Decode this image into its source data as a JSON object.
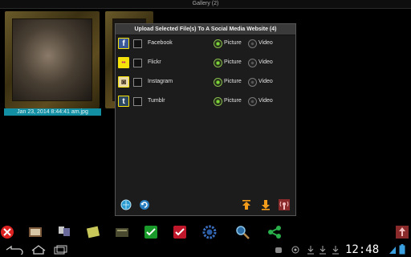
{
  "app": {
    "title": "Gallery (2)"
  },
  "gallery": {
    "caption": "Jan 23, 2014 8:44:41 am.jpg"
  },
  "dialog": {
    "title": "Upload Selected File(s) To A Social Media Website (4)",
    "rows": [
      {
        "site": "Facebook",
        "picture_label": "Picture",
        "video_label": "Video",
        "selected": "picture",
        "icon_color": "#3b5998",
        "icon_glyph": "f",
        "icon": "facebook-icon"
      },
      {
        "site": "Flickr",
        "picture_label": "Picture",
        "video_label": "Video",
        "selected": "picture",
        "icon_color": "#f5e20a",
        "icon_glyph": "••",
        "icon": "flickr-icon"
      },
      {
        "site": "Instagram",
        "picture_label": "Picture",
        "video_label": "Video",
        "selected": "picture",
        "icon_color": "#e9d8a8",
        "icon_glyph": "◙",
        "icon": "instagram-icon"
      },
      {
        "site": "Tumblr",
        "picture_label": "Picture",
        "video_label": "Video",
        "selected": "picture",
        "icon_color": "#2c4762",
        "icon_glyph": "t",
        "icon": "tumblr-icon"
      }
    ]
  },
  "status": {
    "clock": "12:48"
  },
  "colors": {
    "accent": "#128fa3",
    "radio_on": "#7fd33a",
    "icon_border": "#f5e20a"
  }
}
